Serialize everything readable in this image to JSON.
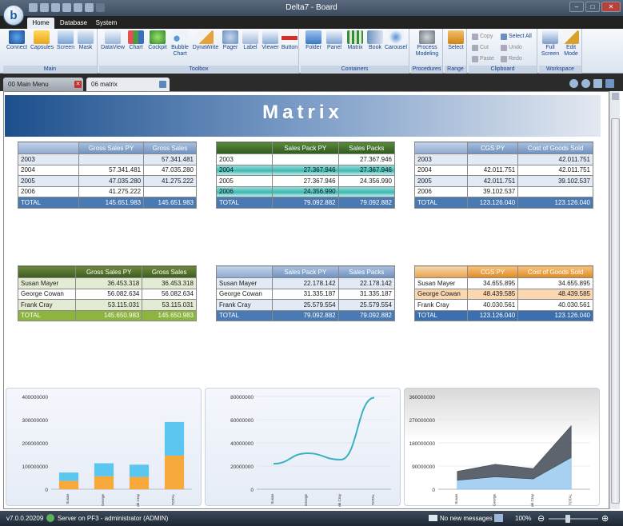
{
  "window": {
    "title": "Delta7 - Board"
  },
  "logo_letter": "b",
  "menu_tabs": [
    "Home",
    "Database",
    "System"
  ],
  "ribbon": {
    "main": {
      "label": "Main",
      "buttons": [
        "Connect",
        "Capsules",
        "Screen",
        "Mask"
      ]
    },
    "toolbox": {
      "label": "Toolbox",
      "buttons": [
        "DataView",
        "Chart",
        "Cockpit",
        "Bubble Chart",
        "DynaWrite",
        "Pager",
        "Label",
        "Viewer",
        "Button"
      ]
    },
    "containers": {
      "label": "Containers",
      "buttons": [
        "Folder",
        "Panel",
        "Matrix",
        "Book",
        "Carousel"
      ]
    },
    "procedures": {
      "label": "Procedures",
      "buttons": [
        "Process Modeling"
      ]
    },
    "range": {
      "label": "Range",
      "buttons": [
        "Select"
      ]
    },
    "clipboard": {
      "label": "Clipboard",
      "items": [
        "Copy",
        "Cut",
        "Paste",
        "Select All",
        "Undo",
        "Redo"
      ]
    },
    "workspace": {
      "label": "Workspace",
      "buttons": [
        "Full Screen",
        "Edit Mode"
      ]
    }
  },
  "doc_tabs": [
    "00 Main Menu",
    "06 matrix"
  ],
  "banner_title": "Matrix",
  "table1": {
    "headers": [
      "",
      "Gross Sales PY",
      "Gross Sales"
    ],
    "rows": [
      [
        "2003",
        "",
        "57.341.481"
      ],
      [
        "2004",
        "57.341.481",
        "47.035.280"
      ],
      [
        "2005",
        "47.035.280",
        "41.275.222"
      ],
      [
        "2006",
        "41.275.222",
        ""
      ]
    ],
    "total": [
      "TOTAL",
      "145.651.983",
      "145.651.983"
    ]
  },
  "table2": {
    "headers": [
      "",
      "Sales Pack PY",
      "Sales Packs"
    ],
    "rows": [
      [
        "2003",
        "",
        "27.367.946"
      ],
      [
        "2004",
        "27.367.946",
        "27.367.946"
      ],
      [
        "2005",
        "27.367.946",
        "24.356.990"
      ],
      [
        "2006",
        "24.356.990",
        ""
      ]
    ],
    "total": [
      "TOTAL",
      "79.092.882",
      "79.092.882"
    ]
  },
  "table3": {
    "headers": [
      "",
      "CGS PY",
      "Cost of Goods Sold"
    ],
    "rows": [
      [
        "2003",
        "",
        "42.011.751"
      ],
      [
        "2004",
        "42.011.751",
        "42.011.751"
      ],
      [
        "2005",
        "42.011.751",
        "39.102.537"
      ],
      [
        "2006",
        "39.102.537",
        ""
      ]
    ],
    "total": [
      "TOTAL",
      "123.126.040",
      "123.126.040"
    ]
  },
  "table4": {
    "headers": [
      "",
      "Gross Sales PY",
      "Gross Sales"
    ],
    "rows": [
      [
        "Susan Mayer",
        "36.453.318",
        "36.453.318"
      ],
      [
        "George Cowan",
        "56.082.634",
        "56.082.634"
      ],
      [
        "Frank Cray",
        "53.115.031",
        "53.115.031"
      ]
    ],
    "total": [
      "TOTAL",
      "145.650.983",
      "145.650.983"
    ]
  },
  "table5": {
    "headers": [
      "",
      "Sales Pack PY",
      "Sales Packs"
    ],
    "rows": [
      [
        "Susan Mayer",
        "22.178.142",
        "22.178.142"
      ],
      [
        "George Cowan",
        "31.335.187",
        "31.335.187"
      ],
      [
        "Frank Cray",
        "25.579.554",
        "25.579.554"
      ]
    ],
    "total": [
      "TOTAL",
      "79.092.882",
      "79.092.882"
    ]
  },
  "table6": {
    "headers": [
      "",
      "CGS PY",
      "Cost of Goods Sold"
    ],
    "rows": [
      [
        "Susan Mayer",
        "34.655.895",
        "34.655.895"
      ],
      [
        "George Cowan",
        "48.439.585",
        "48.439.585"
      ],
      [
        "Frank Cray",
        "40.030.561",
        "40.030.561"
      ]
    ],
    "total": [
      "TOTAL",
      "123.126.040",
      "123.126.040"
    ]
  },
  "chart_data": [
    {
      "type": "bar",
      "stacked": true,
      "categories": [
        "Susan",
        "George",
        "Frank Cray",
        "TOTAL"
      ],
      "series": [
        {
          "values": [
            36000000,
            56000000,
            53000000,
            145000000
          ],
          "color": "#f7a93c"
        },
        {
          "values": [
            36000000,
            56000000,
            53000000,
            145000000
          ],
          "color": "#5bc6ef"
        }
      ],
      "ylim": [
        0,
        400000000
      ],
      "yticks": [
        "400000000",
        "300000000",
        "200000000",
        "100000000",
        "0"
      ]
    },
    {
      "type": "line",
      "categories": [
        "Susan",
        "George",
        "Frank Cray",
        "TOTAL"
      ],
      "series": [
        {
          "values": [
            22000000,
            31000000,
            25500000,
            79000000
          ],
          "color": "#3bb0c0"
        }
      ],
      "ylim": [
        0,
        80000000
      ],
      "yticks": [
        "80000000",
        "60000000",
        "40000000",
        "20000000",
        "0"
      ]
    },
    {
      "type": "area",
      "categories": [
        "Susan",
        "George",
        "Frank Cray",
        "TOTAL"
      ],
      "series": [
        {
          "values": [
            34600000,
            48400000,
            40000000,
            123100000
          ],
          "color": "#a8d0f0"
        },
        {
          "values": [
            34600000,
            48400000,
            40000000,
            123100000
          ],
          "color": "#4d545e"
        }
      ],
      "ylim": [
        0,
        360000000
      ],
      "yticks": [
        "360000000",
        "270000000",
        "180000000",
        "90000000",
        "0"
      ]
    }
  ],
  "status": {
    "version": "v7.0.0.20209",
    "server": "Server on PF3 - administrator (ADMIN)",
    "messages": "No new messages",
    "zoom": "100%"
  }
}
